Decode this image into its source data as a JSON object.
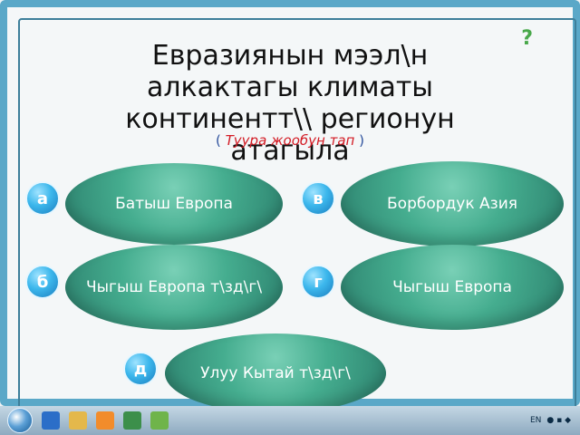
{
  "help": "?",
  "question": {
    "title": "Евразиянын мээл\\н алкактагы климаты континентт\\\\ регионун атагыла",
    "hint": "Туура жообун тап",
    "open_paren": "(",
    "close_paren": ")"
  },
  "options": [
    {
      "letter": "а",
      "label": "Батыш Европа"
    },
    {
      "letter": "в",
      "label": "Борбордук Азия"
    },
    {
      "letter": "б",
      "label": "Чыгыш Европа т\\зд\\г\\"
    },
    {
      "letter": "г",
      "label": "Чыгыш Европа"
    },
    {
      "letter": "д",
      "label": "Улуу Кытай т\\зд\\г\\"
    }
  ],
  "taskbar": {
    "lang": "EN",
    "icons": [
      "windows-start-icon",
      "ie-icon",
      "folder-icon",
      "media-player-icon",
      "app-icon",
      "tool-icon"
    ]
  },
  "colors": {
    "pill": "#45ad8f",
    "badge": "#3cb7ec",
    "hint": "#d31b24"
  }
}
